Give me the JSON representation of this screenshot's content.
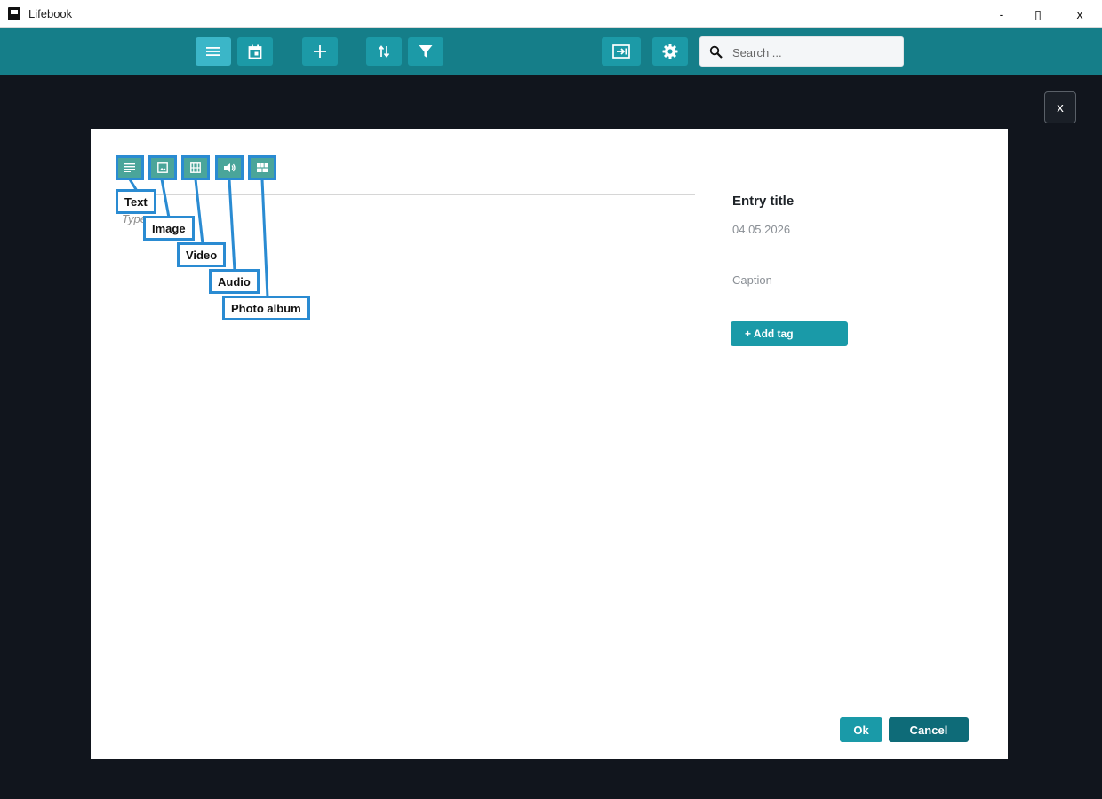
{
  "window": {
    "title": "Lifebook",
    "minimize": "-",
    "maximize": "▯",
    "close": "x"
  },
  "toolbar": {
    "buttons": [
      {
        "icon": "list-icon",
        "active": true
      },
      {
        "icon": "calendar-icon",
        "active": false
      },
      {
        "icon": "plus-icon",
        "active": false
      },
      {
        "icon": "sort-icon",
        "active": false
      },
      {
        "icon": "filter-icon",
        "active": false
      },
      {
        "icon": "export-icon",
        "active": false
      },
      {
        "icon": "gear-icon",
        "active": false
      }
    ],
    "search": {
      "placeholder": "Search ...",
      "value": "",
      "icon": "search-icon"
    }
  },
  "overlay": {
    "close_label": "x"
  },
  "dialog": {
    "content_placeholder": "Type ...",
    "content_types": [
      {
        "label": "Text",
        "icon": "text-icon"
      },
      {
        "label": "Image",
        "icon": "image-icon"
      },
      {
        "label": "Video",
        "icon": "video-icon"
      },
      {
        "label": "Audio",
        "icon": "audio-icon"
      },
      {
        "label": "Photo album",
        "icon": "photo-album-icon"
      }
    ],
    "entry_title": "Entry title",
    "date": "04.05.2026",
    "caption": "Caption",
    "add_tag_label": "+ Add tag",
    "ok_label": "Ok",
    "cancel_label": "Cancel"
  },
  "colors": {
    "toolbar_bg": "#157e89",
    "button_bg": "#1c9aa7",
    "button_active_bg": "#3bb6c8",
    "callout_border": "#2a8bd2",
    "cancel_bg": "#0e6b78",
    "backdrop": "#11151d"
  }
}
